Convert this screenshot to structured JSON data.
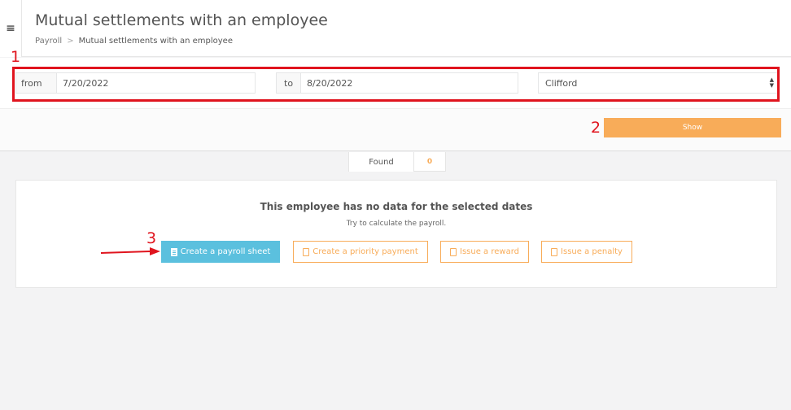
{
  "header": {
    "menu_icon": "hamburger-icon",
    "title": "Mutual settlements with an employee",
    "breadcrumb": {
      "root": "Payroll",
      "separator": ">",
      "current": "Mutual settlements with an employee"
    }
  },
  "filters": {
    "from_label": "from",
    "from_value": "7/20/2022",
    "to_label": "to",
    "to_value": "8/20/2022",
    "employee_selected": "Clifford"
  },
  "show_button": "Show",
  "found": {
    "label": "Found",
    "count": "0"
  },
  "empty_state": {
    "title": "This employee has no data for the selected dates",
    "subtitle": "Try to calculate the payroll."
  },
  "actions": {
    "create_payroll_sheet": "Create a payroll sheet",
    "create_priority_payment": "Create a priority payment",
    "issue_reward": "Issue a reward",
    "issue_penalty": "Issue a penalty"
  },
  "annotations": {
    "one": "1",
    "two": "2",
    "three": "3"
  },
  "colors": {
    "accent_orange": "#f8ac59",
    "info_blue": "#5bc0de",
    "annotation_red": "#e0141e"
  }
}
